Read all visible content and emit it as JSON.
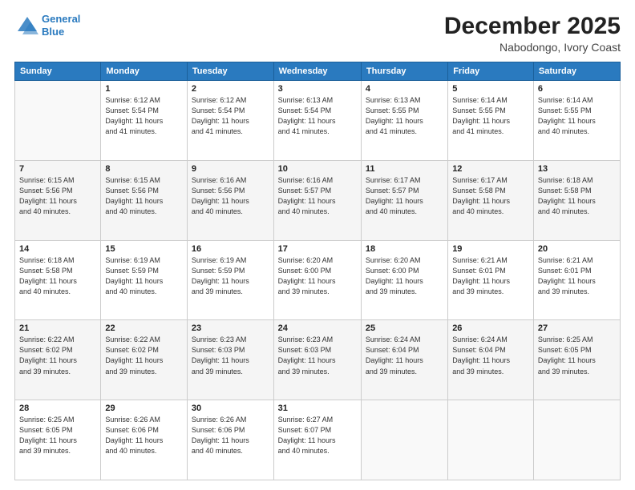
{
  "header": {
    "logo_line1": "General",
    "logo_line2": "Blue",
    "title": "December 2025",
    "subtitle": "Nabodongo, Ivory Coast"
  },
  "calendar": {
    "days_of_week": [
      "Sunday",
      "Monday",
      "Tuesday",
      "Wednesday",
      "Thursday",
      "Friday",
      "Saturday"
    ],
    "weeks": [
      [
        {
          "day": "",
          "info": ""
        },
        {
          "day": "1",
          "info": "Sunrise: 6:12 AM\nSunset: 5:54 PM\nDaylight: 11 hours\nand 41 minutes."
        },
        {
          "day": "2",
          "info": "Sunrise: 6:12 AM\nSunset: 5:54 PM\nDaylight: 11 hours\nand 41 minutes."
        },
        {
          "day": "3",
          "info": "Sunrise: 6:13 AM\nSunset: 5:54 PM\nDaylight: 11 hours\nand 41 minutes."
        },
        {
          "day": "4",
          "info": "Sunrise: 6:13 AM\nSunset: 5:55 PM\nDaylight: 11 hours\nand 41 minutes."
        },
        {
          "day": "5",
          "info": "Sunrise: 6:14 AM\nSunset: 5:55 PM\nDaylight: 11 hours\nand 41 minutes."
        },
        {
          "day": "6",
          "info": "Sunrise: 6:14 AM\nSunset: 5:55 PM\nDaylight: 11 hours\nand 40 minutes."
        }
      ],
      [
        {
          "day": "7",
          "info": "Sunrise: 6:15 AM\nSunset: 5:56 PM\nDaylight: 11 hours\nand 40 minutes."
        },
        {
          "day": "8",
          "info": "Sunrise: 6:15 AM\nSunset: 5:56 PM\nDaylight: 11 hours\nand 40 minutes."
        },
        {
          "day": "9",
          "info": "Sunrise: 6:16 AM\nSunset: 5:56 PM\nDaylight: 11 hours\nand 40 minutes."
        },
        {
          "day": "10",
          "info": "Sunrise: 6:16 AM\nSunset: 5:57 PM\nDaylight: 11 hours\nand 40 minutes."
        },
        {
          "day": "11",
          "info": "Sunrise: 6:17 AM\nSunset: 5:57 PM\nDaylight: 11 hours\nand 40 minutes."
        },
        {
          "day": "12",
          "info": "Sunrise: 6:17 AM\nSunset: 5:58 PM\nDaylight: 11 hours\nand 40 minutes."
        },
        {
          "day": "13",
          "info": "Sunrise: 6:18 AM\nSunset: 5:58 PM\nDaylight: 11 hours\nand 40 minutes."
        }
      ],
      [
        {
          "day": "14",
          "info": "Sunrise: 6:18 AM\nSunset: 5:58 PM\nDaylight: 11 hours\nand 40 minutes."
        },
        {
          "day": "15",
          "info": "Sunrise: 6:19 AM\nSunset: 5:59 PM\nDaylight: 11 hours\nand 40 minutes."
        },
        {
          "day": "16",
          "info": "Sunrise: 6:19 AM\nSunset: 5:59 PM\nDaylight: 11 hours\nand 39 minutes."
        },
        {
          "day": "17",
          "info": "Sunrise: 6:20 AM\nSunset: 6:00 PM\nDaylight: 11 hours\nand 39 minutes."
        },
        {
          "day": "18",
          "info": "Sunrise: 6:20 AM\nSunset: 6:00 PM\nDaylight: 11 hours\nand 39 minutes."
        },
        {
          "day": "19",
          "info": "Sunrise: 6:21 AM\nSunset: 6:01 PM\nDaylight: 11 hours\nand 39 minutes."
        },
        {
          "day": "20",
          "info": "Sunrise: 6:21 AM\nSunset: 6:01 PM\nDaylight: 11 hours\nand 39 minutes."
        }
      ],
      [
        {
          "day": "21",
          "info": "Sunrise: 6:22 AM\nSunset: 6:02 PM\nDaylight: 11 hours\nand 39 minutes."
        },
        {
          "day": "22",
          "info": "Sunrise: 6:22 AM\nSunset: 6:02 PM\nDaylight: 11 hours\nand 39 minutes."
        },
        {
          "day": "23",
          "info": "Sunrise: 6:23 AM\nSunset: 6:03 PM\nDaylight: 11 hours\nand 39 minutes."
        },
        {
          "day": "24",
          "info": "Sunrise: 6:23 AM\nSunset: 6:03 PM\nDaylight: 11 hours\nand 39 minutes."
        },
        {
          "day": "25",
          "info": "Sunrise: 6:24 AM\nSunset: 6:04 PM\nDaylight: 11 hours\nand 39 minutes."
        },
        {
          "day": "26",
          "info": "Sunrise: 6:24 AM\nSunset: 6:04 PM\nDaylight: 11 hours\nand 39 minutes."
        },
        {
          "day": "27",
          "info": "Sunrise: 6:25 AM\nSunset: 6:05 PM\nDaylight: 11 hours\nand 39 minutes."
        }
      ],
      [
        {
          "day": "28",
          "info": "Sunrise: 6:25 AM\nSunset: 6:05 PM\nDaylight: 11 hours\nand 39 minutes."
        },
        {
          "day": "29",
          "info": "Sunrise: 6:26 AM\nSunset: 6:06 PM\nDaylight: 11 hours\nand 40 minutes."
        },
        {
          "day": "30",
          "info": "Sunrise: 6:26 AM\nSunset: 6:06 PM\nDaylight: 11 hours\nand 40 minutes."
        },
        {
          "day": "31",
          "info": "Sunrise: 6:27 AM\nSunset: 6:07 PM\nDaylight: 11 hours\nand 40 minutes."
        },
        {
          "day": "",
          "info": ""
        },
        {
          "day": "",
          "info": ""
        },
        {
          "day": "",
          "info": ""
        }
      ]
    ]
  }
}
